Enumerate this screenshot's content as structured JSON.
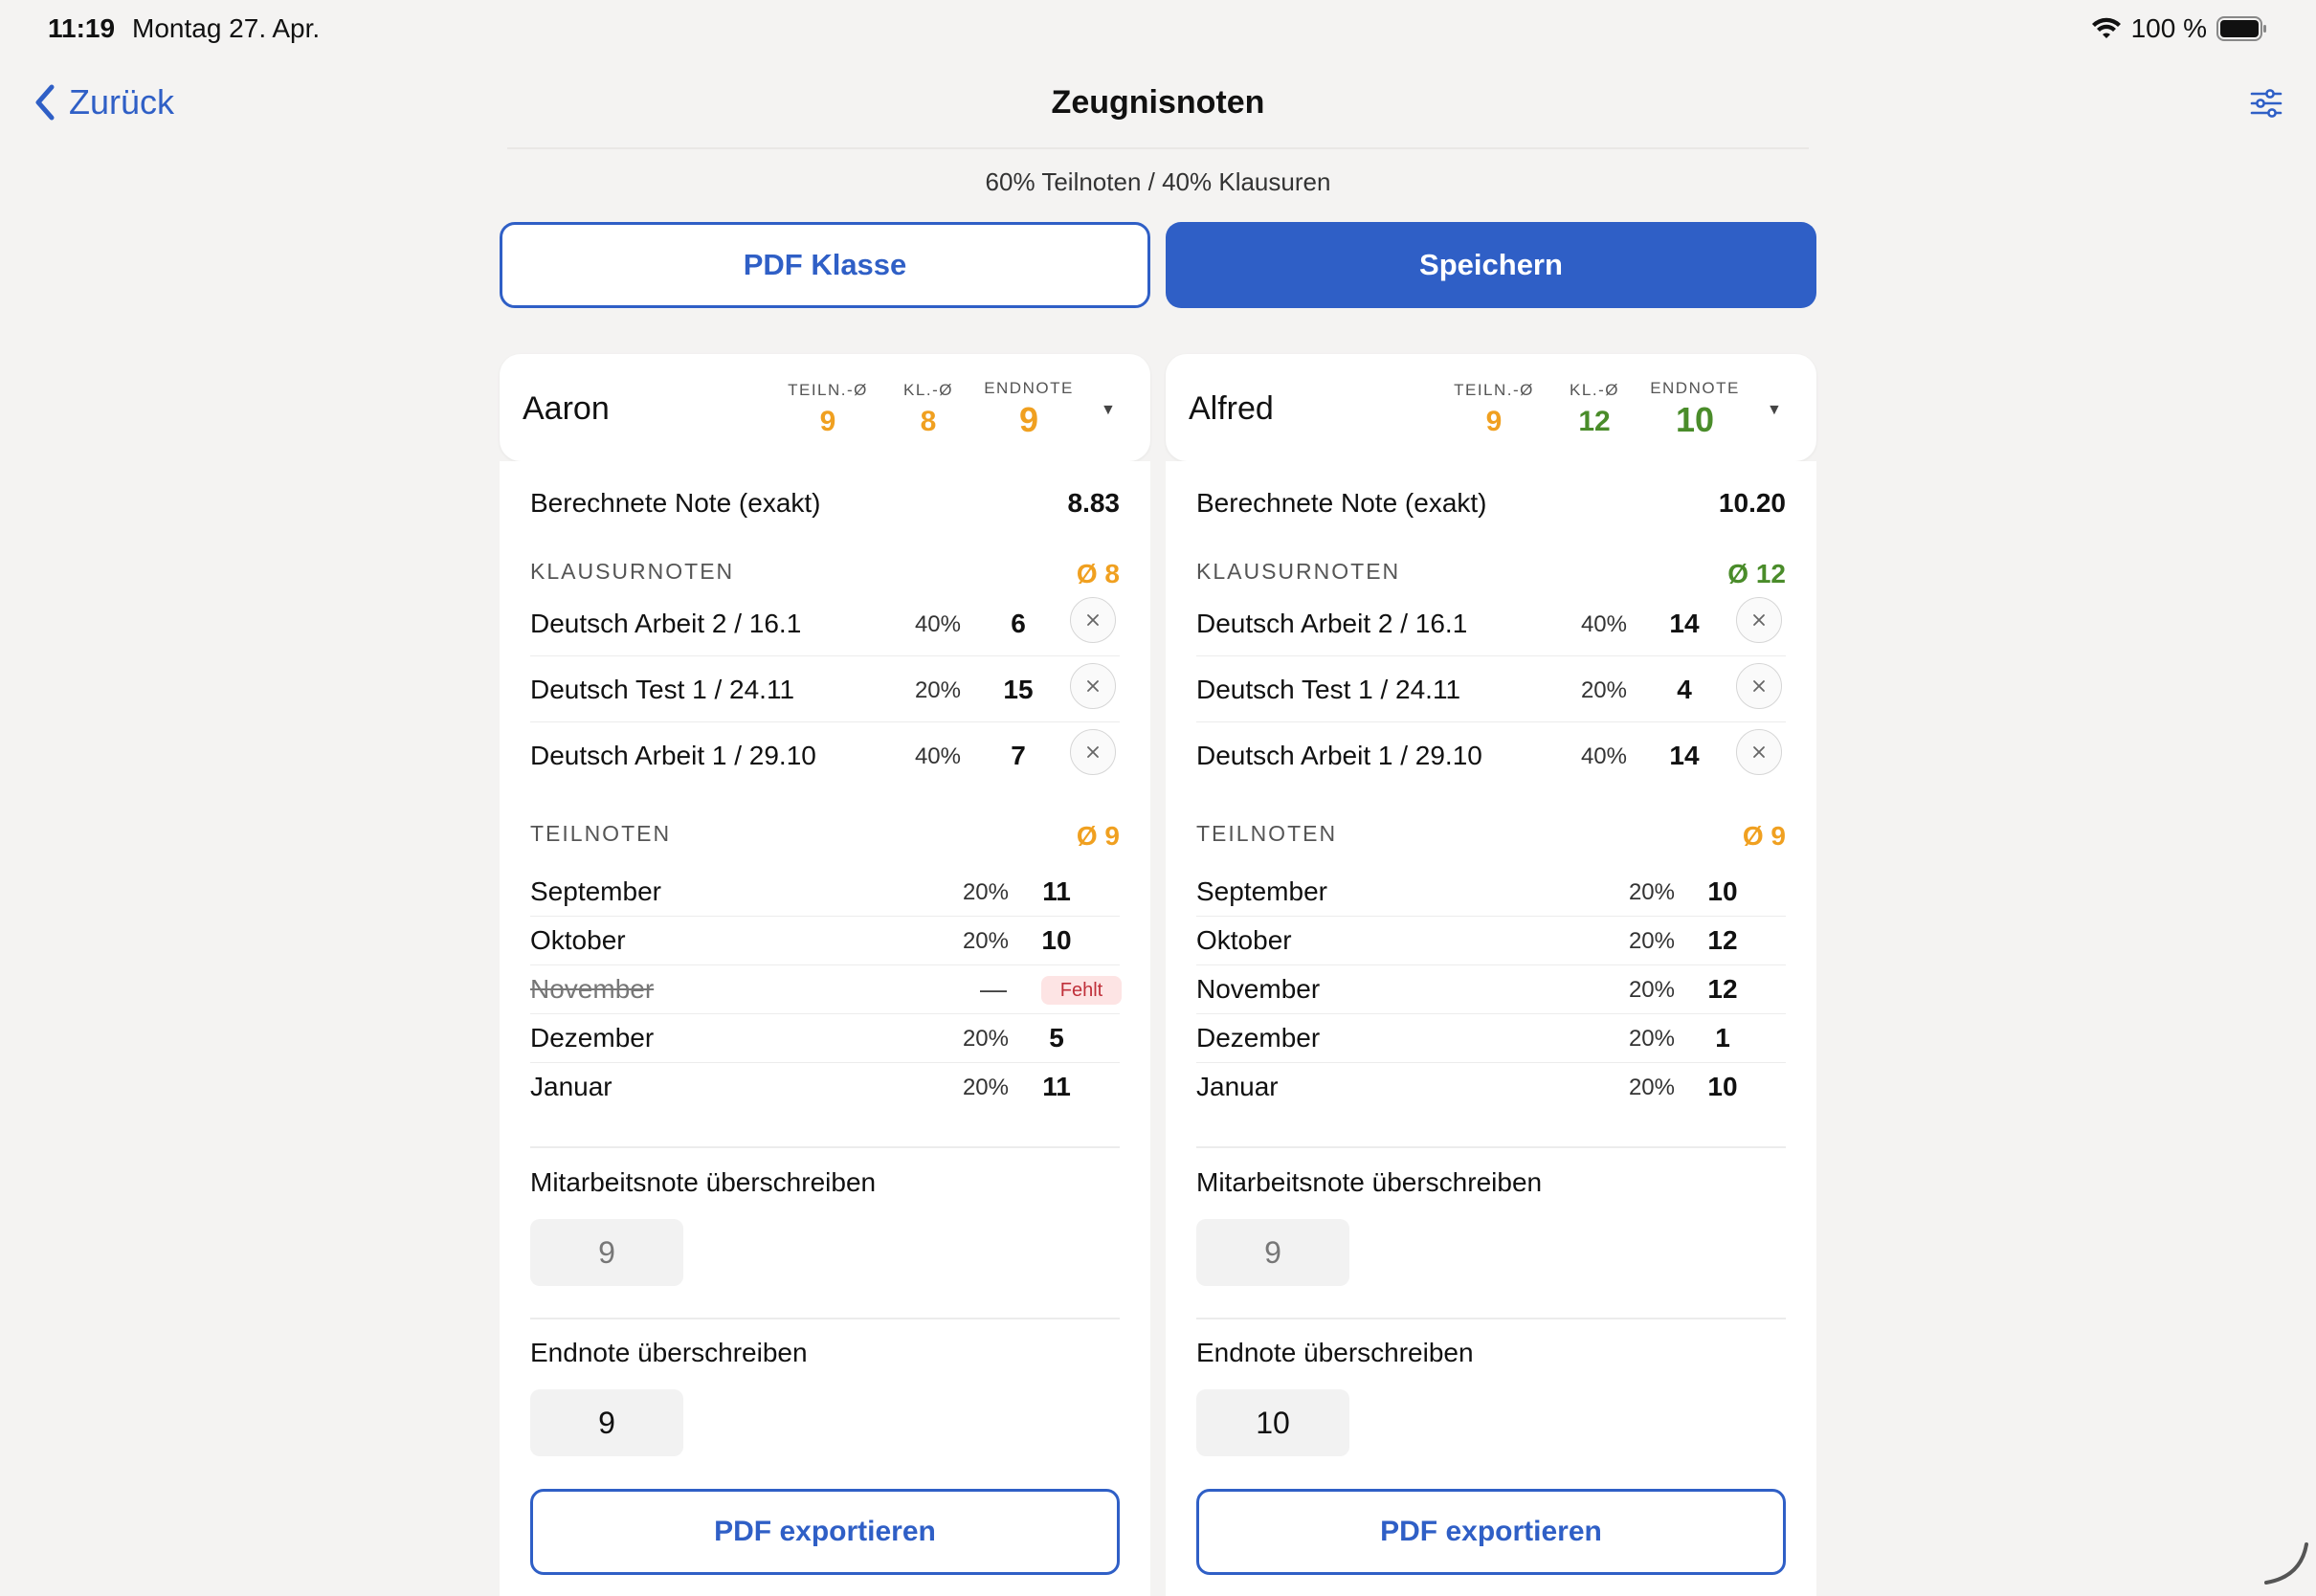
{
  "status": {
    "time": "11:19",
    "date": "Montag 27. Apr.",
    "battery": "100 %"
  },
  "nav": {
    "back_label": "Zurück",
    "title": "Zeugnisnoten"
  },
  "weighting": "60% Teilnoten / 40% Klausuren",
  "buttons": {
    "pdf_class": "PDF Klasse",
    "save": "Speichern"
  },
  "colors": {
    "accent": "#2f5fc6",
    "orange": "#f0a020",
    "green": "#4a8c2a",
    "missing_bg": "#fde4e4",
    "missing_fg": "#c0303a"
  },
  "labels": {
    "teiln_avg": "TEILN.-Ø",
    "kl_avg": "KL.-Ø",
    "endnote": "ENDNOTE",
    "calc": "Berechnete Note (exakt)",
    "exams": "KLAUSURNOTEN",
    "parts": "TEILNOTEN",
    "override_participation": "Mitarbeitsnote überschreiben",
    "override_final": "Endnote überschreiben",
    "pdf_export": "PDF exportieren",
    "missing": "Fehlt",
    "dash": "—"
  },
  "students": [
    {
      "name": "Aaron",
      "teiln_avg": "9",
      "kl_avg": "8",
      "endnote": "9",
      "calc_value": "8.83",
      "exam_avg": "Ø 8",
      "part_avg": "Ø 9",
      "exams": [
        {
          "name": "Deutsch Arbeit 2 / 16.1",
          "pct": "40%",
          "grade": "6"
        },
        {
          "name": "Deutsch Test 1 / 24.11",
          "pct": "20%",
          "grade": "15"
        },
        {
          "name": "Deutsch Arbeit 1 / 29.10",
          "pct": "40%",
          "grade": "7"
        }
      ],
      "parts": [
        {
          "name": "September",
          "pct": "20%",
          "grade": "11"
        },
        {
          "name": "Oktober",
          "pct": "20%",
          "grade": "10"
        },
        {
          "name": "November",
          "pct": "",
          "grade": ""
        },
        {
          "name": "Dezember",
          "pct": "20%",
          "grade": "5"
        },
        {
          "name": "Januar",
          "pct": "20%",
          "grade": "11"
        }
      ],
      "override_participation": "9",
      "override_final": "9"
    },
    {
      "name": "Alfred",
      "teiln_avg": "9",
      "kl_avg": "12",
      "endnote": "10",
      "calc_value": "10.20",
      "exam_avg": "Ø 12",
      "part_avg": "Ø 9",
      "exams": [
        {
          "name": "Deutsch Arbeit 2 / 16.1",
          "pct": "40%",
          "grade": "14"
        },
        {
          "name": "Deutsch Test 1 / 24.11",
          "pct": "20%",
          "grade": "4"
        },
        {
          "name": "Deutsch Arbeit 1 / 29.10",
          "pct": "40%",
          "grade": "14"
        }
      ],
      "parts": [
        {
          "name": "September",
          "pct": "20%",
          "grade": "10"
        },
        {
          "name": "Oktober",
          "pct": "20%",
          "grade": "12"
        },
        {
          "name": "November",
          "pct": "20%",
          "grade": "12"
        },
        {
          "name": "Dezember",
          "pct": "20%",
          "grade": "1"
        },
        {
          "name": "Januar",
          "pct": "20%",
          "grade": "10"
        }
      ],
      "override_participation": "9",
      "override_final": "10"
    }
  ]
}
